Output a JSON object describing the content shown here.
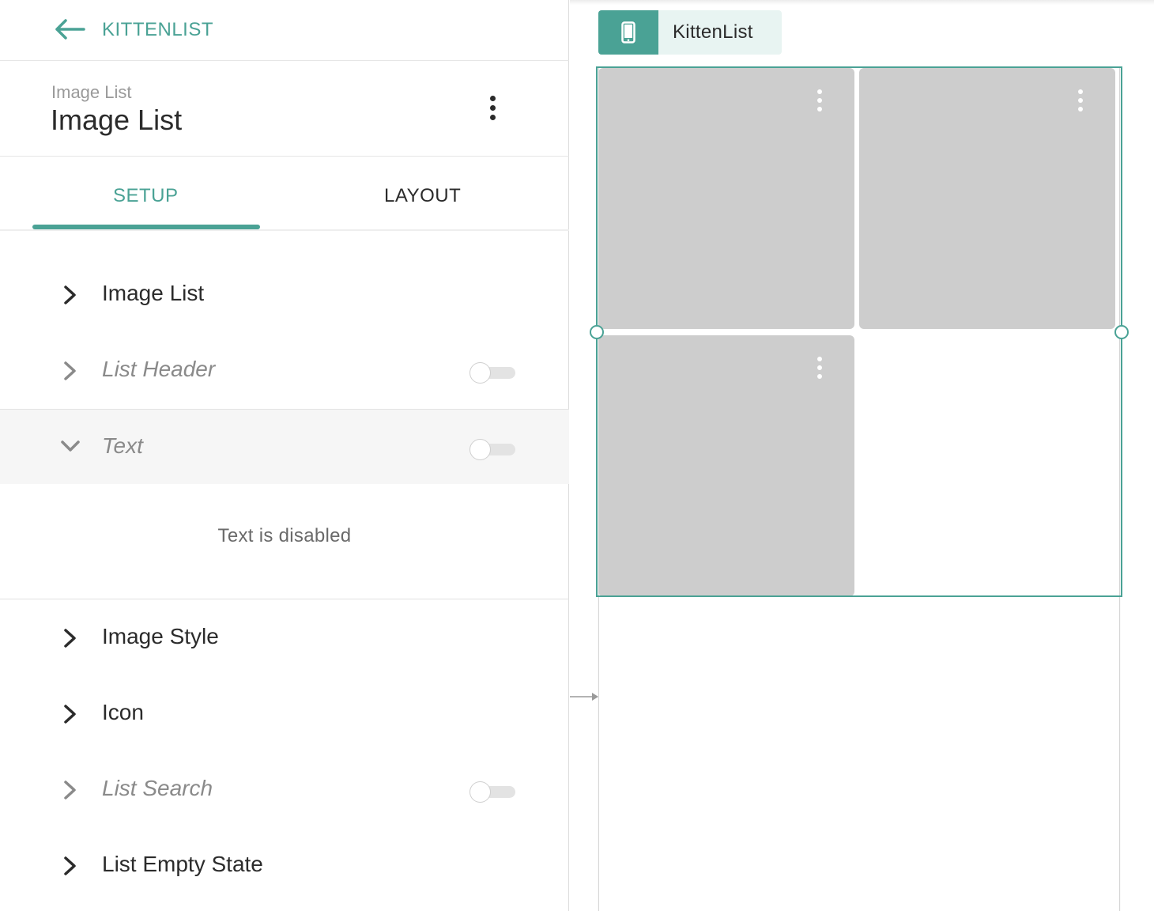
{
  "app": {
    "back_label": "KITTENLIST",
    "accent_color": "#4aa295"
  },
  "header": {
    "subtitle": "Image List",
    "title": "Image List",
    "menu_icon": "kebab-vertical-icon"
  },
  "tabs": [
    {
      "label": "SETUP",
      "active": true
    },
    {
      "label": "LAYOUT",
      "active": false
    }
  ],
  "sections": [
    {
      "label": "Image List",
      "expanded": false,
      "has_toggle": false
    },
    {
      "label": "List Header",
      "expanded": false,
      "has_toggle": true,
      "toggle_on": false
    },
    {
      "label": "Text",
      "expanded": true,
      "has_toggle": true,
      "toggle_on": false
    },
    {
      "label": "Image Style",
      "expanded": false,
      "has_toggle": false
    },
    {
      "label": "Icon",
      "expanded": false,
      "has_toggle": false
    },
    {
      "label": "List Search",
      "expanded": false,
      "has_toggle": true,
      "toggle_on": false
    },
    {
      "label": "List Empty State",
      "expanded": false,
      "has_toggle": false
    }
  ],
  "text_section": {
    "disabled_message": "Text is disabled"
  },
  "preview": {
    "screen_label": "KittenList",
    "screen_icon": "mobile-phone-icon",
    "tiles": [
      {
        "menu_icon": "kebab-vertical-icon"
      },
      {
        "menu_icon": "kebab-vertical-icon"
      },
      {
        "menu_icon": "kebab-vertical-icon"
      }
    ]
  }
}
